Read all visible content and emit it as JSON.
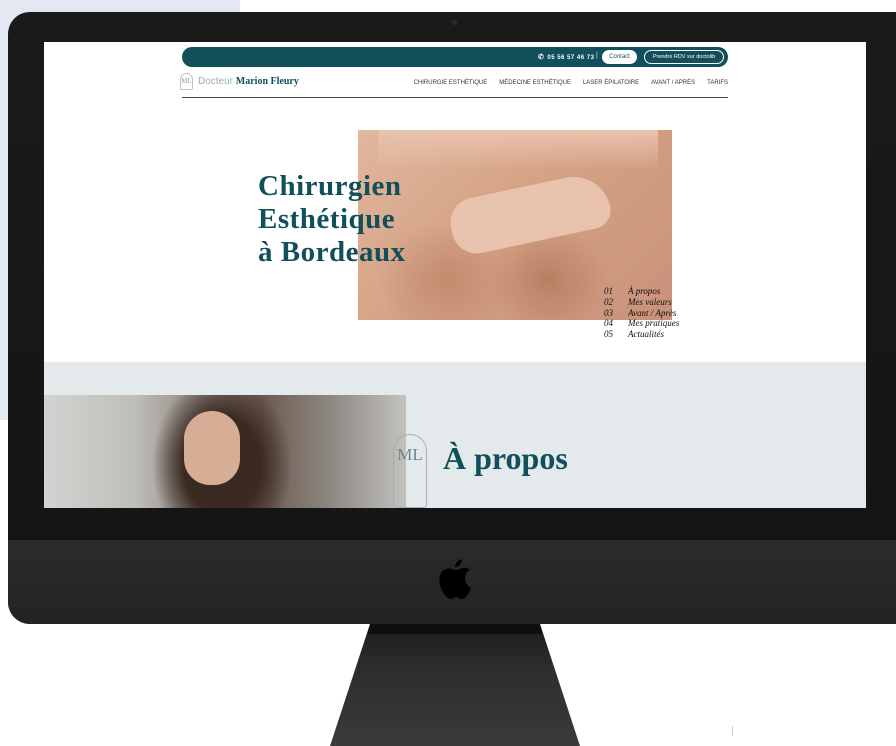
{
  "website": {
    "topbar": {
      "phone": "05 56 57 46 73",
      "separator": "|",
      "contact_label": "Contact",
      "rdv_label": "Prendre RDV sur doctolib"
    },
    "logo": {
      "mark": "ML",
      "prefix": "Docteur",
      "name": "Marion Fleury"
    },
    "nav": {
      "items": [
        {
          "label": "CHIRURGIE ESTHÉTIQUE"
        },
        {
          "label": "MÉDECINE ESTHÉTIQUE"
        },
        {
          "label": "LASER ÉPILATOIRE"
        },
        {
          "label": "AVANT / APRÈS"
        },
        {
          "label": "TARIFS"
        }
      ]
    },
    "hero": {
      "title_lines": [
        "Chirurgien",
        "Esthétique",
        "à Bordeaux"
      ]
    },
    "section_list": [
      {
        "num": "01",
        "label": "À propos"
      },
      {
        "num": "02",
        "label": "Mes valeurs"
      },
      {
        "num": "03",
        "label": "Avant / Après"
      },
      {
        "num": "04",
        "label": "Mes pratiques"
      },
      {
        "num": "05",
        "label": "Actualités"
      }
    ],
    "about": {
      "mark": "ML",
      "title": "À propos"
    }
  },
  "colors": {
    "brand": "#11505a",
    "band": "#e4e9ec",
    "monitor": "#1a1a1b"
  },
  "icons": {
    "phone": "phone-icon",
    "apple": "apple-logo-icon"
  }
}
